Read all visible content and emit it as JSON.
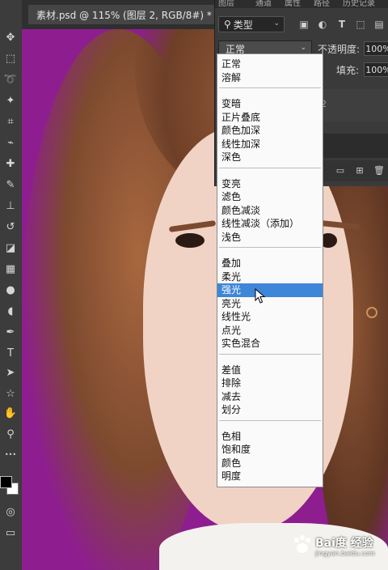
{
  "document": {
    "tab_title": "素材.psd @ 115% (图层 2, RGB/8#) *",
    "close_glyph": "×"
  },
  "toolbar": {
    "tools": [
      {
        "name": "move-tool",
        "glyph": "✥"
      },
      {
        "name": "marquee-tool",
        "glyph": "⬚"
      },
      {
        "name": "lasso-tool",
        "glyph": "➰"
      },
      {
        "name": "magic-wand-tool",
        "glyph": "✦"
      },
      {
        "name": "crop-tool",
        "glyph": "⌗"
      },
      {
        "name": "eyedropper-tool",
        "glyph": "⌁"
      },
      {
        "name": "healing-brush-tool",
        "glyph": "✚"
      },
      {
        "name": "brush-tool",
        "glyph": "✎"
      },
      {
        "name": "clone-stamp-tool",
        "glyph": "⊥"
      },
      {
        "name": "history-brush-tool",
        "glyph": "↺"
      },
      {
        "name": "eraser-tool",
        "glyph": "◪"
      },
      {
        "name": "gradient-tool",
        "glyph": "▦"
      },
      {
        "name": "blur-tool",
        "glyph": "●"
      },
      {
        "name": "dodge-tool",
        "glyph": "◖"
      },
      {
        "name": "pen-tool",
        "glyph": "✒"
      },
      {
        "name": "type-tool",
        "glyph": "T"
      },
      {
        "name": "path-selection-tool",
        "glyph": "➤"
      },
      {
        "name": "shape-tool",
        "glyph": "☆"
      },
      {
        "name": "hand-tool",
        "glyph": "✋"
      },
      {
        "name": "zoom-tool",
        "glyph": "⚲"
      },
      {
        "name": "more-tools",
        "glyph": "•••"
      }
    ],
    "extra": [
      {
        "name": "quick-mask-tool",
        "glyph": "◎"
      },
      {
        "name": "screen-mode-tool",
        "glyph": "▭"
      }
    ]
  },
  "layers_panel": {
    "tabs": [
      "图层",
      "通道",
      "属性",
      "路径",
      "历史记录"
    ],
    "filter_label": "类型",
    "filter_icons": [
      "image-filter-icon",
      "adjustment-filter-icon",
      "type-filter-icon",
      "shape-filter-icon",
      "smart-object-filter-icon"
    ],
    "blend_mode": "正常",
    "opacity_label": "不透明度:",
    "opacity_value": "100%",
    "fill_label": "填充:",
    "fill_value": "100%",
    "layer_number_fragment": "2"
  },
  "blend_menu": {
    "groups": [
      [
        "正常",
        "溶解"
      ],
      [
        "变暗",
        "正片叠底",
        "颜色加深",
        "线性加深",
        "深色"
      ],
      [
        "变亮",
        "滤色",
        "颜色减淡",
        "线性减淡（添加）",
        "浅色"
      ],
      [
        "叠加",
        "柔光",
        "强光",
        "亮光",
        "线性光",
        "点光",
        "实色混合"
      ],
      [
        "差值",
        "排除",
        "减去",
        "划分"
      ],
      [
        "色相",
        "饱和度",
        "颜色",
        "明度"
      ]
    ],
    "selected": "强光"
  },
  "colors": {
    "canvas_background": "#8e1e8f",
    "menu_highlight": "#3e86d8",
    "foreground_swatch": "#000000",
    "background_swatch": "#ffffff"
  },
  "watermark": {
    "text": "Bai度 经验",
    "sub": "jingyan.baidu.com"
  }
}
